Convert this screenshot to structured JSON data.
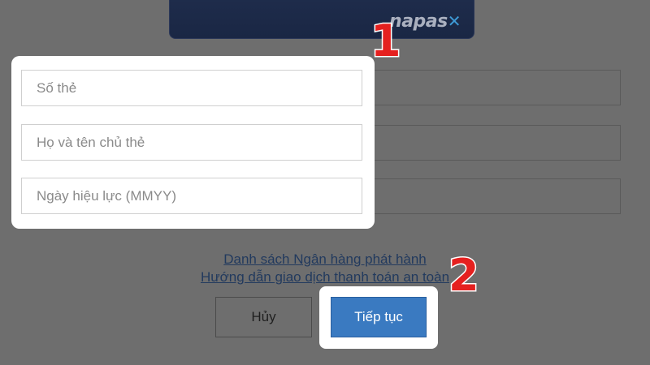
{
  "card": {
    "brand": "napas",
    "brand_mark": "✕"
  },
  "form": {
    "card_number_placeholder": "Số thẻ",
    "cardholder_name_placeholder": "Họ và tên chủ thẻ",
    "valid_from_placeholder": "Ngày hiệu lực (MMYY)"
  },
  "links": {
    "issuing_banks": "Danh sách Ngân hàng phát hành",
    "safe_payment_guide": "Hướng dẫn giao dịch thanh toán an toàn"
  },
  "buttons": {
    "cancel": "Hủy",
    "continue": "Tiếp tục"
  },
  "annotations": {
    "step1": "1",
    "step2": "2"
  },
  "colors": {
    "overlay": "#6e6e6e",
    "primary_button": "#3a7ac1",
    "step_number": "#e5201f"
  }
}
